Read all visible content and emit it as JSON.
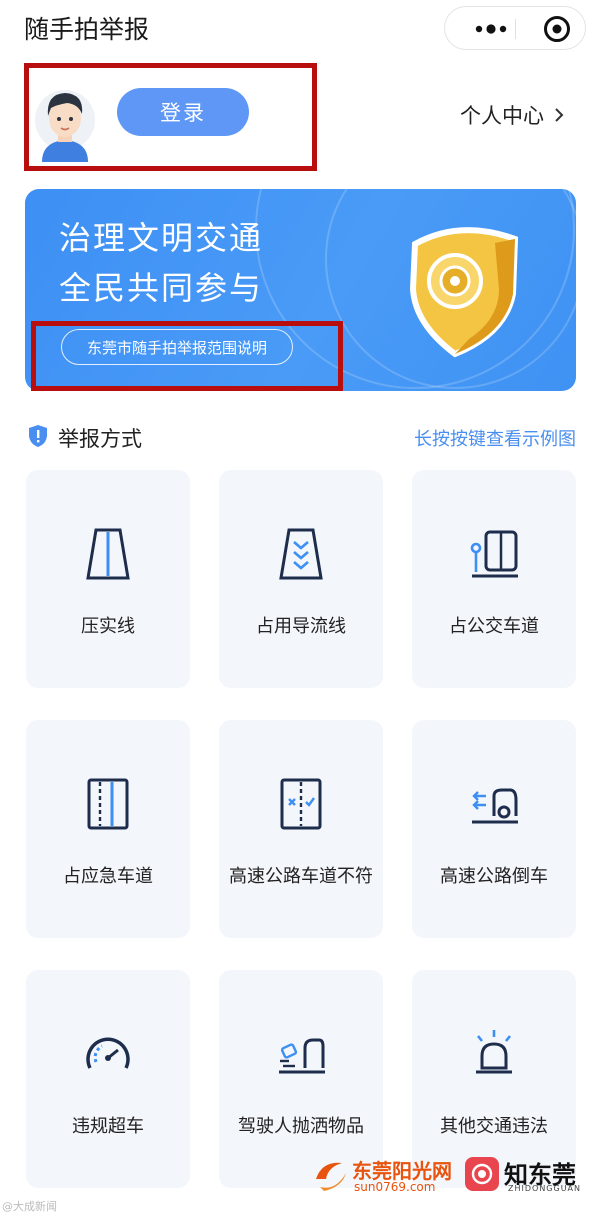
{
  "app": {
    "title": "随手拍举报"
  },
  "header": {
    "login_label": "登录",
    "personal_center": "个人中心"
  },
  "banner": {
    "line1": "治理文明交通",
    "line2": "全民共同参与",
    "scope_button": "东莞市随手拍举报范围说明"
  },
  "section": {
    "title": "举报方式",
    "hint_link": "长按按键查看示例图"
  },
  "report_types": [
    {
      "label": "压实线",
      "icon": "solid-line-icon"
    },
    {
      "label": "占用导流线",
      "icon": "diversion-line-icon"
    },
    {
      "label": "占公交车道",
      "icon": "bus-lane-icon"
    },
    {
      "label": "占应急车道",
      "icon": "emergency-lane-icon"
    },
    {
      "label": "高速公路车道不符",
      "icon": "lane-mismatch-icon"
    },
    {
      "label": "高速公路倒车",
      "icon": "reverse-car-icon"
    },
    {
      "label": "违规超车",
      "icon": "speedometer-icon"
    },
    {
      "label": "驾驶人抛洒物品",
      "icon": "littering-icon"
    },
    {
      "label": "其他交通违法",
      "icon": "siren-icon"
    }
  ],
  "watermark": {
    "brand1": "东莞阳光网",
    "brand1_url": "sun0769.com",
    "brand2": "知东莞",
    "brand2_sub": "ZHIDONGGUAN",
    "corner": "@大成新闻"
  },
  "colors": {
    "accent": "#5e97f6",
    "highlight_box": "#b80e0e",
    "icon_navy": "#1f2d4d",
    "icon_blue": "#3d8ff4"
  }
}
